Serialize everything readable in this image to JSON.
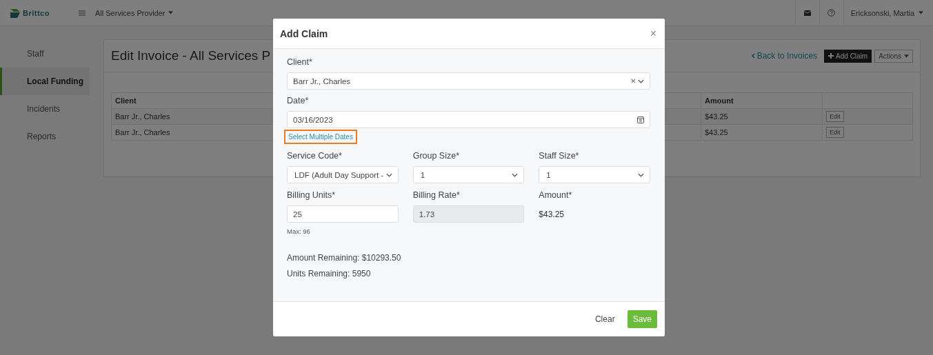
{
  "topbar": {
    "brand": "Brittco",
    "provider": "All Services Provider",
    "user": "Ericksonski, Martia"
  },
  "sidebar": {
    "items": [
      {
        "label": "Staff",
        "selected": false
      },
      {
        "label": "Local Funding",
        "selected": true
      },
      {
        "label": "Incidents",
        "selected": false
      },
      {
        "label": "Reports",
        "selected": false
      }
    ]
  },
  "invoice": {
    "title": "Edit Invoice - All Services P",
    "back_link": "Back to Invoices",
    "add_button": "Add Claim",
    "actions_button": "Actions",
    "table": {
      "columns": [
        "Client",
        "Amount"
      ],
      "rows": [
        {
          "client": "Barr Jr., Charles",
          "amount": "$43.25",
          "action": "Edit"
        },
        {
          "client": "Barr Jr., Charles",
          "amount": "$43.25",
          "action": "Edit"
        }
      ]
    }
  },
  "modal": {
    "title": "Add Claim",
    "close": "×",
    "client": {
      "label": "Client*",
      "value": "Barr Jr., Charles",
      "clear": "×"
    },
    "date": {
      "label": "Date*",
      "value": "03/16/2023"
    },
    "multi_dates_link": {
      "text": "Select Multiple Dates",
      "highlighted": true
    },
    "selects": [
      {
        "label": "Service Code*",
        "value": "LDF (Adult Day Support -"
      },
      {
        "label": "Group Size*",
        "value": "1"
      },
      {
        "label": "Staff Size*",
        "value": "1"
      }
    ],
    "billing_units": {
      "label": "Billing Units*",
      "value": "25",
      "hint": "Max: 96"
    },
    "billing_rate": {
      "label": "Billing Rate*",
      "value": "1.73",
      "disabled": true
    },
    "amount": {
      "label": "Amount*",
      "value": "$43.25"
    },
    "amount_remaining": "Amount Remaining: $10293.50",
    "units_remaining": "Units Remaining: 5950",
    "buttons": {
      "clear": "Clear",
      "save": "Save"
    }
  }
}
